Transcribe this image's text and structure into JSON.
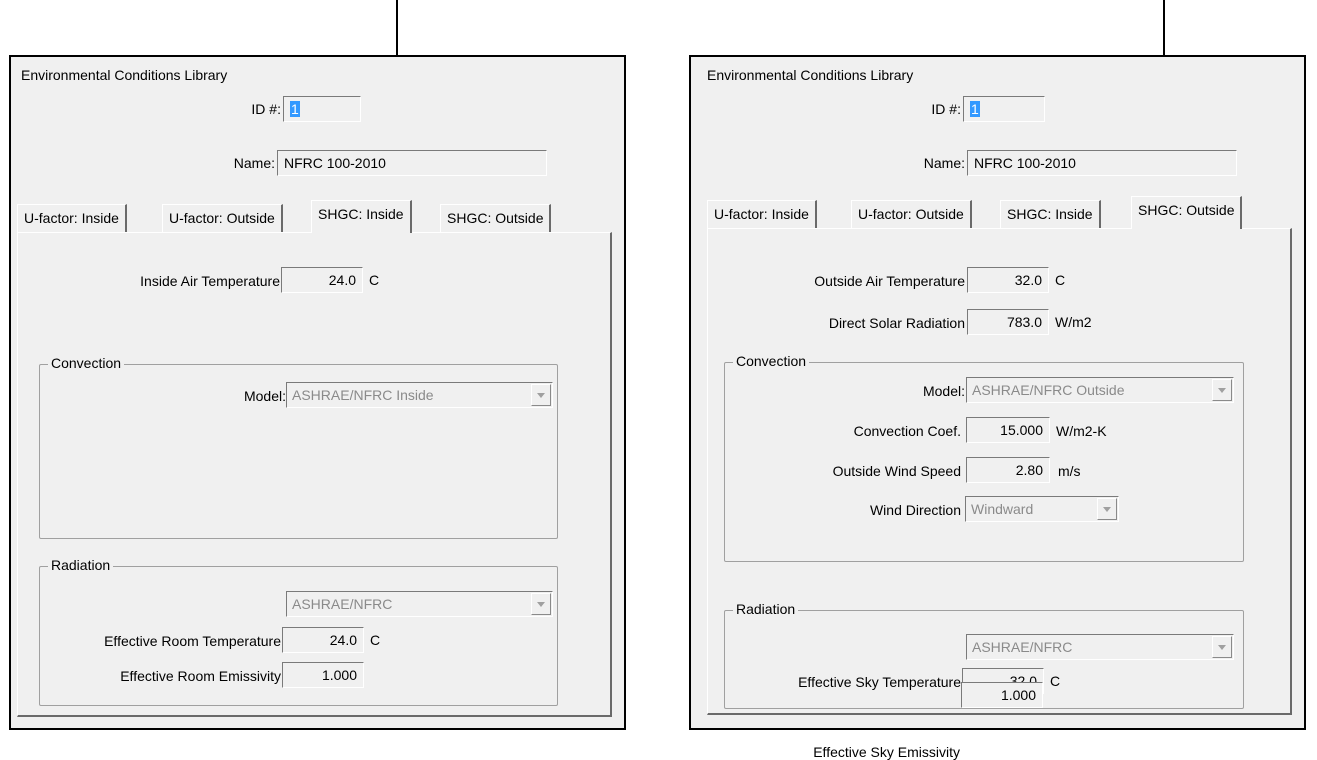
{
  "left": {
    "title": "Environmental Conditions Library",
    "id_label": "ID #:",
    "id_value": "1",
    "name_label": "Name:",
    "name_value": "NFRC 100-2010",
    "tabs": [
      "U-factor: Inside",
      "U-factor: Outside",
      "SHGC: Inside",
      "SHGC: Outside"
    ],
    "active_tab": "SHGC: Inside",
    "air_temp_label": "Inside Air Temperature",
    "air_temp_value": "24.0",
    "air_temp_unit": "C",
    "convection": {
      "title": "Convection",
      "model_label": "Model:",
      "model_value": "ASHRAE/NFRC Inside"
    },
    "radiation": {
      "title": "Radiation",
      "model_value": "ASHRAE/NFRC",
      "temp_label": "Effective Room Temperature",
      "temp_value": "24.0",
      "temp_unit": "C",
      "emis_label": "Effective Room Emissivity",
      "emis_value": "1.000"
    }
  },
  "right": {
    "title": "Environmental Conditions Library",
    "id_label": "ID #:",
    "id_value": "1",
    "name_label": "Name:",
    "name_value": "NFRC 100-2010",
    "tabs": [
      "U-factor: Inside",
      "U-factor: Outside",
      "SHGC: Inside",
      "SHGC: Outside"
    ],
    "active_tab": "SHGC: Outside",
    "air_temp_label": "Outside Air Temperature",
    "air_temp_value": "32.0",
    "air_temp_unit": "C",
    "solar_label": "Direct Solar Radiation",
    "solar_value": "783.0",
    "solar_unit": "W/m2",
    "convection": {
      "title": "Convection",
      "model_label": "Model:",
      "model_value": "ASHRAE/NFRC Outside",
      "coef_label": "Convection Coef.",
      "coef_value": "15.000",
      "coef_unit": "W/m2-K",
      "wind_speed_label": "Outside Wind Speed",
      "wind_speed_value": "2.80",
      "wind_speed_unit": "m/s",
      "wind_dir_label": "Wind Direction",
      "wind_dir_value": "Windward"
    },
    "radiation": {
      "title": "Radiation",
      "model_value": "ASHRAE/NFRC",
      "temp_label": "Effective Sky Temperature",
      "temp_value": "32.0",
      "temp_unit": "C",
      "emis_label": "Effective Sky Emissivity",
      "emis_value": "1.000"
    }
  }
}
